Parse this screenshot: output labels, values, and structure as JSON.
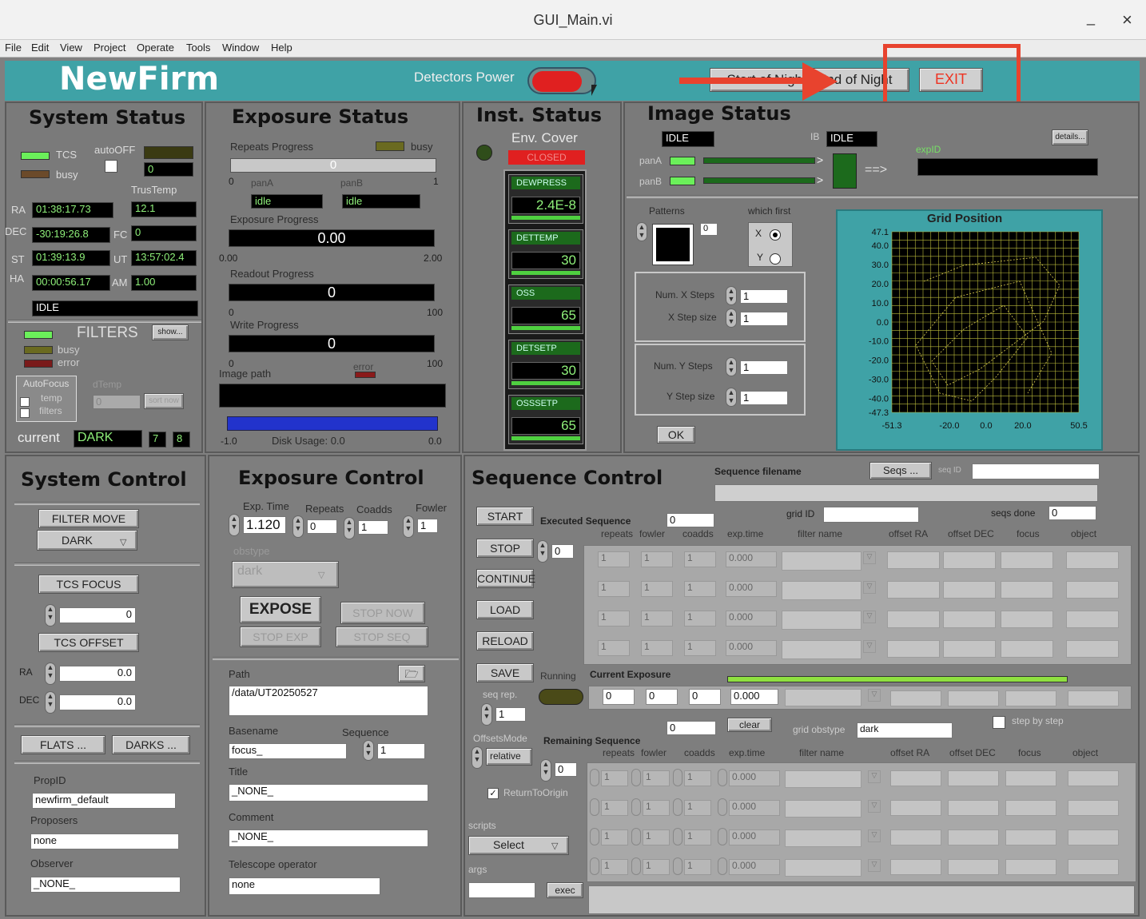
{
  "window": {
    "title": "GUI_Main.vi",
    "min": "_",
    "close": "×"
  },
  "menu": [
    "File",
    "Edit",
    "View",
    "Project",
    "Operate",
    "Tools",
    "Window",
    "Help"
  ],
  "header": {
    "app": "NewFirm",
    "power_label": "Detectors Power",
    "night_button": "Start of Night / End of Night",
    "exit": "EXIT"
  },
  "system_status": {
    "title": "System Status",
    "tcs": "TCS",
    "busy": "busy",
    "autooff": "autoOFF",
    "autooff_val": "0",
    "trustemp": "TrusTemp",
    "ra_l": "RA",
    "ra": "01:38:17.73",
    "t1": "12.1",
    "dec_l": "DEC",
    "dec": "-30:19:26.8",
    "fc_l": "FC",
    "fc": "0",
    "st_l": "ST",
    "st": "01:39:13.9",
    "ut_l": "UT",
    "ut": "13:57:02.4",
    "ha_l": "HA",
    "ha": "00:00:56.17",
    "am_l": "AM",
    "am": "1.00",
    "state": "IDLE"
  },
  "filters": {
    "title": "FILTERS",
    "show": "show...",
    "busy": "busy",
    "error": "error",
    "autofocus": "AutoFocus",
    "temp": "temp",
    "filters": "filters",
    "dtemp": "dTemp",
    "dtemp_val": "0",
    "sort_now": "sort now",
    "current": "current",
    "current_val": "DARK",
    "n1": "7",
    "n2": "8"
  },
  "exposure_status": {
    "title": "Exposure Status",
    "repeats": "Repeats Progress",
    "busy": "busy",
    "rep_val": "0",
    "rep_min": "0",
    "rep_max": "1",
    "pana": "panA",
    "panb": "panB",
    "pana_v": "idle",
    "panb_v": "idle",
    "exp_prog": "Exposure Progress",
    "exp_val": "0.00",
    "exp_min": "0.00",
    "exp_max": "2.00",
    "readout": "Readout Progress",
    "read_val": "0",
    "read_min": "0",
    "read_max": "100",
    "write": "Write Progress",
    "write_val": "0",
    "write_min": "0",
    "write_max": "100",
    "imgpath": "Image path",
    "error": "error",
    "disk_min": "-1.0",
    "disk": "Disk Usage: 0.0",
    "disk_max": "0.0"
  },
  "inst_status": {
    "title": "Inst. Status",
    "env": "Env. Cover",
    "closed": "CLOSED",
    "items": [
      {
        "n": "DEWPRESS",
        "v": "2.4E-8"
      },
      {
        "n": "DETTEMP",
        "v": "30"
      },
      {
        "n": "OSS",
        "v": "65"
      },
      {
        "n": "DETSETP",
        "v": "30"
      },
      {
        "n": "OSSSETP",
        "v": "65"
      }
    ]
  },
  "image_status": {
    "title": "Image Status",
    "state": "IDLE",
    "ib": "IB",
    "ib_state": "IDLE",
    "details": "details...",
    "pana": "panA",
    "panb": "panB",
    "arrow": "==>",
    "expid": "expID",
    "patterns": "Patterns",
    "pat_val": "0",
    "which": "which first",
    "x": "X",
    "y": "Y",
    "nx": "Num. X Steps",
    "nx_v": "1",
    "xs": "X Step size",
    "xs_v": "1",
    "ny": "Num. Y Steps",
    "ny_v": "1",
    "ys": "Y Step size",
    "ys_v": "1",
    "ok": "OK"
  },
  "grid": {
    "title": "Grid Position",
    "yticks": [
      "47.1",
      "40.0",
      "30.0",
      "20.0",
      "10.0",
      "0.0",
      "-10.0",
      "-20.0",
      "-30.0",
      "-40.0",
      "-47.3"
    ],
    "xticks": [
      "-51.3",
      "-20.0",
      "0.0",
      "20.0",
      "50.5"
    ]
  },
  "system_control": {
    "title": "System Control",
    "filter_move": "FILTER MOVE",
    "dark": "DARK",
    "tcs_focus": "TCS FOCUS",
    "focus_val": "0",
    "tcs_offset": "TCS OFFSET",
    "ra": "RA",
    "ra_v": "0.0",
    "dec": "DEC",
    "dec_v": "0.0",
    "flats": "FLATS ...",
    "darks": "DARKS ...",
    "propid": "PropID",
    "propid_v": "newfirm_default",
    "proposers": "Proposers",
    "proposers_v": "none",
    "observer": "Observer",
    "observer_v": "_NONE_"
  },
  "exposure_control": {
    "title": "Exposure Control",
    "exptime": "Exp. Time",
    "exptime_v": "1.120",
    "repeats": "Repeats",
    "repeats_v": "0",
    "coadds": "Coadds",
    "coadds_v": "1",
    "fowler": "Fowler",
    "fowler_v": "1",
    "obstype": "obstype",
    "obstype_v": "dark",
    "expose": "EXPOSE",
    "stop_now": "STOP NOW",
    "stop_exp": "STOP EXP",
    "stop_seq": "STOP SEQ",
    "path": "Path",
    "path_v": "/data/UT20250527",
    "basename": "Basename",
    "basename_v": "focus_",
    "sequence": "Sequence",
    "sequence_v": "1",
    "title_l": "Title",
    "title_v": "_NONE_",
    "comment": "Comment",
    "comment_v": "_NONE_",
    "telop": "Telescope operator",
    "telop_v": "none"
  },
  "sequence_control": {
    "title": "Sequence Control",
    "seqfile": "Sequence filename",
    "seqs": "Seqs ...",
    "seqid": "seq ID",
    "start": "START",
    "stop": "STOP",
    "continue": "CONTINUE",
    "load": "LOAD",
    "reload": "RELOAD",
    "save": "SAVE",
    "executed": "Executed Sequence",
    "exec_v": "0",
    "gridid": "grid ID",
    "seqsdone": "seqs done",
    "seqsdone_v": "0",
    "stop_v": "0",
    "cols": [
      "repeats",
      "fowler",
      "coadds",
      "exp.time",
      "filter name",
      "offset RA",
      "offset DEC",
      "focus",
      "object"
    ],
    "row_vals": [
      "1",
      "1",
      "1",
      "0.000"
    ],
    "running": "Running",
    "current": "Current Exposure",
    "cur_vals": [
      "0",
      "0",
      "0",
      "0.000"
    ],
    "seqrep": "seq rep.",
    "seqrep_v": "1",
    "cnt": "0",
    "clear": "clear",
    "gridobstype": "grid obstype",
    "gridobstype_v": "dark",
    "stepbystep": "step by step",
    "offsets": "OffsetsMode",
    "relative": "relative",
    "remaining": "Remaining Sequence",
    "rem_v": "0",
    "return": "ReturnToOrigin",
    "scripts": "scripts",
    "select": "Select",
    "args": "args",
    "exec": "exec"
  }
}
